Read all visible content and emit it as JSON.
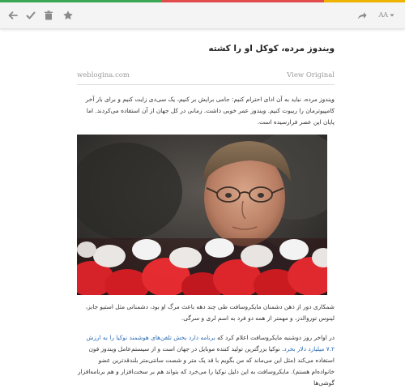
{
  "colors": {
    "stripe": [
      "#3aa757",
      "#3aa757",
      "#e34c4c",
      "#e34c4c",
      "#f0b400"
    ],
    "toolbar_icon": "#8a8a8a",
    "link": "#2d6bb5"
  },
  "toolbar": {
    "left_icons": [
      "back-arrow-icon",
      "checkmark-icon",
      "trash-icon",
      "star-icon"
    ],
    "right_icons": [
      "share-arrow-icon",
      "text-size-icon"
    ],
    "text_size_label": "AA"
  },
  "article": {
    "title": "ویندوز مرده، کوکل او را کشته",
    "site": "weblogina.com",
    "view_original": "View Original",
    "intro": "ویندوز مرده، نباید به آن ادای احترام کنیم: جامی برایش بر کنیم، یک سی‌دی زایت کنیم و برای بار آخر کامپیوترمان را ریبوت کنیم. ویندوز عمر خوبی داشت. زمانی در کل جهان از آن استفاده می‌کردند. اما پایان این عصر فرارسیده است.",
    "caption": "شمکاری دور از ذهن دشمنان مایکروسافت طی چند دهه باعث مرگ او بود، دشمنانی مثل استیو جابز، لینوس توروالدز، و مهمتر از همه دو فرد به اسم لری و سرگی.",
    "body_before_link": "در اواخر روز دوشنبه مایکروسافت اعلام کرد که ",
    "body_link": "برنامه دارد بخش تلفن‌های هوشمند نوکیا را به ارزش ۷.۲ میلیارد دلار بخرد",
    "body_after_link": ". نوکیا بزرگترین تولید کننده موبایل در جهان است و از سیستم‌عامل ویندوز فون استفاده می‌کند (مثل این می‌ماند که من بگویم با قد یک متر و شصت سانتی‌متر بلندقدترین عضو خانواده‌ام هستم). مایکروسافت به این دلیل نوکیا را می‌خرد که بتواند هم بر سخت‌افزار و هم برنامه‌افزار گوشی‌ها"
  }
}
